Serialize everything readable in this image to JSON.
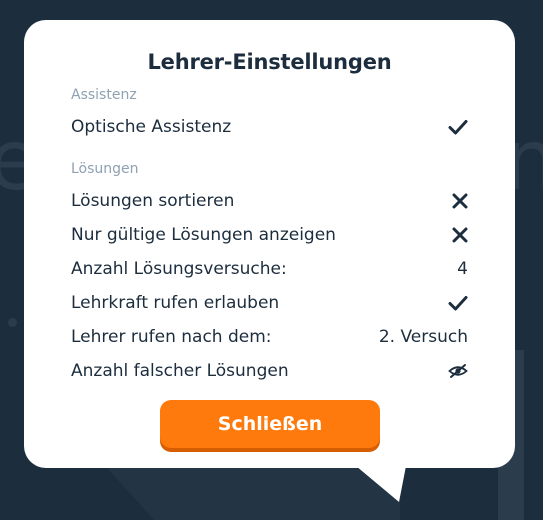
{
  "dialog": {
    "title": "Lehrer-Einstellungen",
    "sections": [
      {
        "heading": "Assistenz",
        "rows": [
          {
            "label": "Optische Assistenz",
            "icon": "check-icon"
          }
        ]
      },
      {
        "heading": "Lösungen",
        "rows": [
          {
            "label": "Lösungen sortieren",
            "icon": "x-icon"
          },
          {
            "label": "Nur gültige Lösungen anzeigen",
            "icon": "x-icon"
          },
          {
            "label": "Anzahl Lösungsversuche:",
            "value": "4"
          },
          {
            "label": "Lehrkraft rufen erlauben",
            "icon": "check-icon"
          },
          {
            "label": "Lehrer rufen nach dem:",
            "value": "2. Versuch"
          },
          {
            "label": "Anzahl falscher Lösungen",
            "icon": "eye-slash-icon"
          }
        ]
      }
    ],
    "close_label": "Schließen"
  },
  "colors": {
    "background": "#1c2d3e",
    "text": "#1c2d3e",
    "section_heading": "#8fa1b3",
    "button": "#ff7a0d"
  }
}
